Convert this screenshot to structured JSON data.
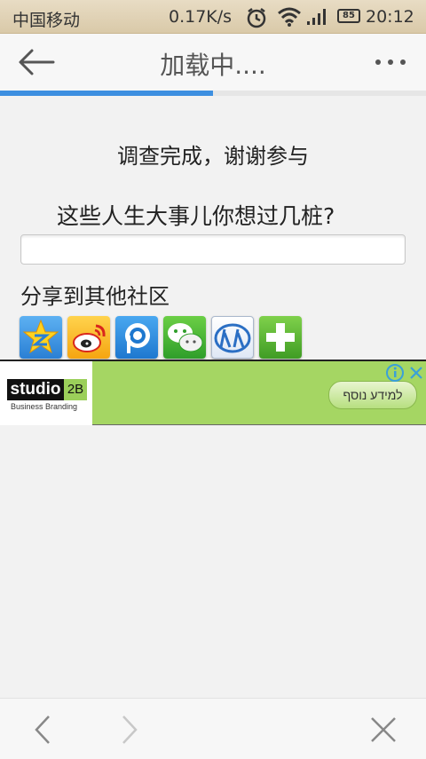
{
  "status_bar": {
    "carrier": "中国移动",
    "speed": "0.17K/s",
    "battery": "85",
    "time": "20:12"
  },
  "title_bar": {
    "title": "加载中....",
    "progress_percent": 50
  },
  "content": {
    "done_message": "调查完成，谢谢参与",
    "question": "这些人生大事儿你想过几桩?",
    "answer_value": "",
    "share_label": "分享到其他社区"
  },
  "share_icons": [
    {
      "name": "qzone-icon",
      "color": "#3a8fe0"
    },
    {
      "name": "weibo-icon",
      "color": "#f0a81a"
    },
    {
      "name": "pengyou-icon",
      "color": "#2c8fd8"
    },
    {
      "name": "wechat-icon",
      "color": "#2fa52f"
    },
    {
      "name": "renren-icon",
      "color": "#2b6fc4"
    },
    {
      "name": "more-share-icon",
      "color": "#5ab53a"
    }
  ],
  "ad": {
    "logo_main": "studio",
    "logo_suffix": "2B",
    "tagline": "Business Branding",
    "cta_label": "למידע נוסף",
    "background": "#a5d663"
  }
}
